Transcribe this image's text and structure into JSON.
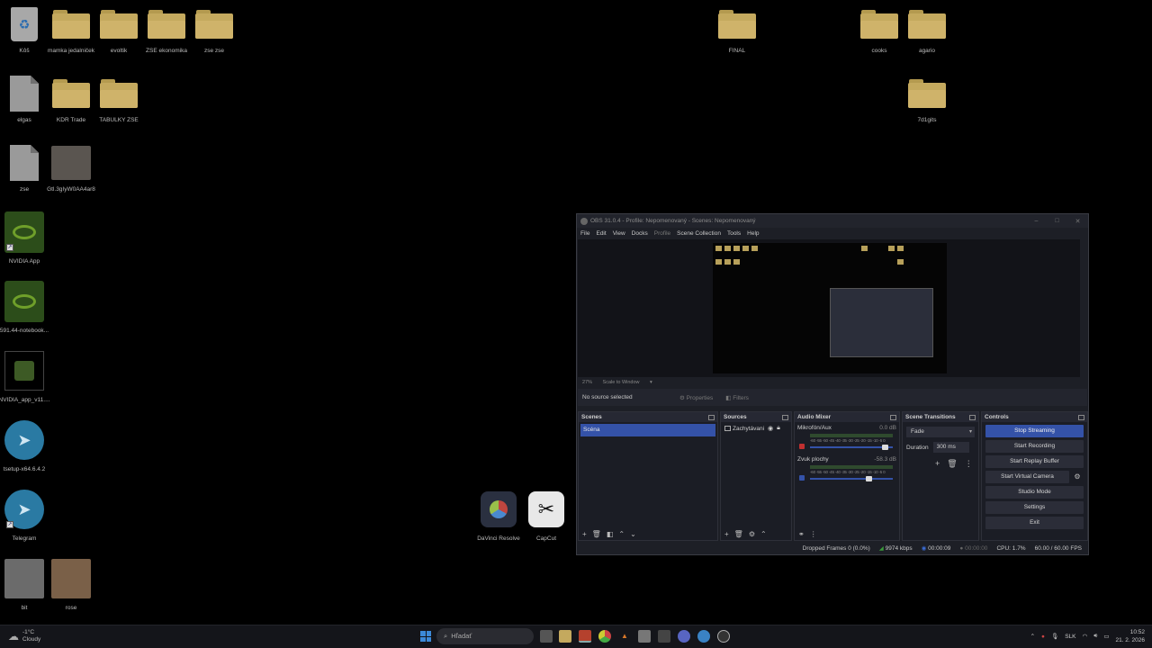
{
  "desktop": {
    "icons": {
      "recycle": "Kôš",
      "mamka": "mamka jedalniček",
      "evoltik": "evoltik",
      "zse_ekonomika": "ZSE ekonomika",
      "zse_zse": "zse zse",
      "final": "FINAL",
      "cooks": "cooks",
      "agario": "agario",
      "elgas": "elgas",
      "kdr": "KDR Trade",
      "tabulky": "TABULKY ZSE",
      "z7d1gits": "7d1gits",
      "zse": "zse",
      "photo1": "Gtl.3gIyW0AA4ar8",
      "nvidia_app": "NVIDIA App",
      "nvidia_notebook": "591.44-notebook...",
      "nvidia_app_v": "NVIDIA_app_v11....",
      "tsetup": "tsetup-x64.6.4.2",
      "telegram": "Telegram",
      "bit": "bit",
      "rose": "rose",
      "davinci": "DaVinci Resolve",
      "capcut": "CapCut"
    }
  },
  "obs": {
    "title": "OBS 31.0.4 - Profile: Nepomenovaný - Scenes: Nepomenovaný",
    "menu": [
      "File",
      "Edit",
      "View",
      "Docks",
      "Profile",
      "Scene Collection",
      "Tools",
      "Help"
    ],
    "zoom": "27%",
    "scale_mode": "Scale to Window",
    "no_source": "No source selected",
    "properties": "Properties",
    "filters": "Filters",
    "docks": {
      "scenes": {
        "title": "Scenes",
        "items": [
          "Scéna"
        ]
      },
      "sources": {
        "title": "Sources",
        "items": [
          "Zachytávani"
        ]
      },
      "mixer": {
        "title": "Audio Mixer",
        "channels": [
          {
            "name": "Mikrofón/Aux",
            "db": "0.0 dB",
            "level": 0.05
          },
          {
            "name": "Zvuk plochy",
            "db": "-58.3 dB",
            "level": 0.25
          }
        ],
        "scale": "-60 -55 -50 -45 -40 -35 -30 -25 -20 -15 -10 -5 0"
      },
      "transitions": {
        "title": "Scene Transitions",
        "selected": "Fade",
        "duration_label": "Duration",
        "duration_value": "300 ms"
      },
      "controls": {
        "title": "Controls",
        "stop_streaming": "Stop Streaming",
        "start_recording": "Start Recording",
        "start_replay": "Start Replay Buffer",
        "start_virtual": "Start Virtual Camera",
        "studio_mode": "Studio Mode",
        "settings": "Settings",
        "exit": "Exit"
      }
    },
    "status": {
      "dropped": "Dropped Frames 0 (0.0%)",
      "bitrate": "9974 kbps",
      "stream_time": "00:00:09",
      "rec_time": "00:00:00",
      "cpu": "CPU: 1.7%",
      "fps": "60.00 / 60.00 FPS"
    },
    "accent": "#3452a8"
  },
  "taskbar": {
    "weather_temp": "-1°C",
    "weather_desc": "Cloudy",
    "search_placeholder": "Hľadať",
    "lang": "SLK",
    "time": "10:52",
    "date": "21. 2. 2026"
  }
}
